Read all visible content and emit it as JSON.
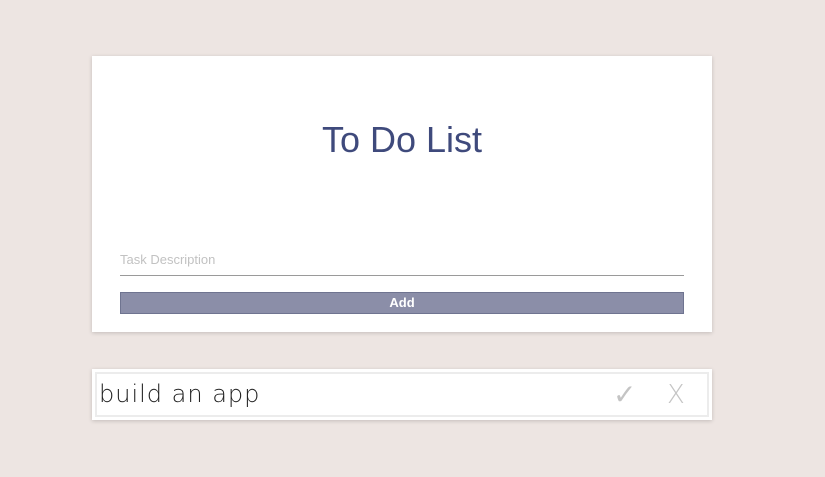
{
  "app": {
    "title": "To Do List"
  },
  "form": {
    "task_input": {
      "placeholder": "Task Description",
      "value": ""
    },
    "add_label": "Add"
  },
  "tasks": [
    {
      "text": "build an app",
      "complete_icon": "✓",
      "delete_icon": "X"
    }
  ],
  "colors": {
    "background": "#ede5e2",
    "title": "#3f4a7c",
    "button": "#8b8ea8",
    "icon": "#c4c4c4"
  }
}
